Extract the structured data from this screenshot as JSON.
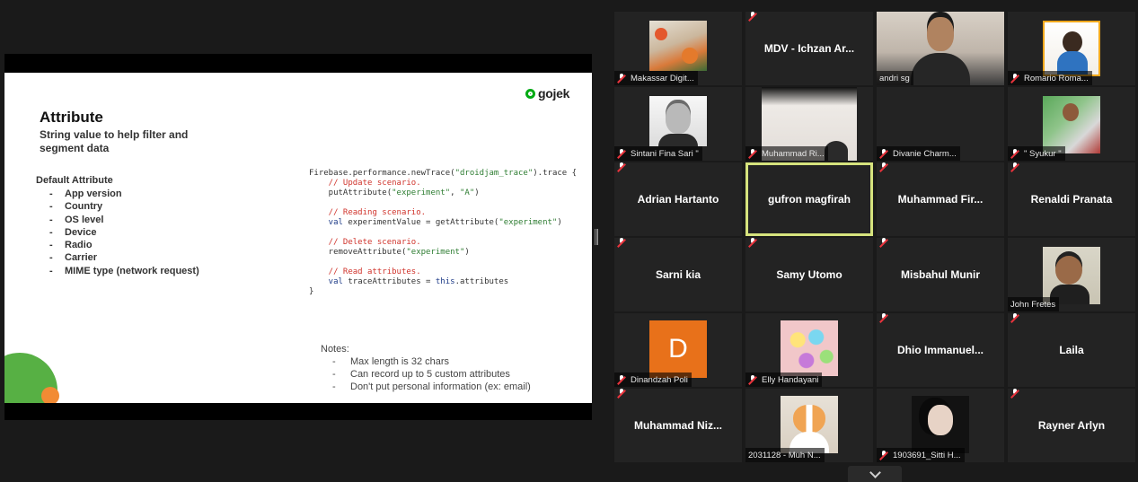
{
  "slide": {
    "logo": "gojek",
    "title": "Attribute",
    "subtitle": "String value to help filter and segment data",
    "default_heading": "Default Attribute",
    "default_items": [
      "App version",
      "Country",
      "OS level",
      "Device",
      "Radio",
      "Carrier",
      "MIME type (network request)"
    ],
    "bullet": "-",
    "code": {
      "l1_a": "Firebase.performance.newTrace(",
      "l1_str": "\"droidjam_trace\"",
      "l1_b": ").trace {",
      "l2": "    // Update scenario.",
      "l3_a": "    putAttribute(",
      "l3_s1": "\"experiment\"",
      "l3_sep": ", ",
      "l3_s2": "\"A\"",
      "l3_b": ")",
      "l5": "    // Reading scenario.",
      "l6_kw": "    val",
      "l6_a": " experimentValue = getAttribute(",
      "l6_str": "\"experiment\"",
      "l6_b": ")",
      "l8": "    // Delete scenario.",
      "l9_a": "    removeAttribute(",
      "l9_str": "\"experiment\"",
      "l9_b": ")",
      "l11": "    // Read attributes.",
      "l12_kw": "    val",
      "l12_a": " traceAttributes = ",
      "l12_kw2": "this",
      "l12_b": ".attributes",
      "l13": "}"
    },
    "notes_title": "Notes:",
    "notes": [
      "Max length is 32 chars",
      "Can record up to 5 custom attributes",
      "Don't put personal information (ex: email)"
    ]
  },
  "participants": [
    {
      "label": "Makassar Digit..."
    },
    {
      "center": "MDV - Ichzan Ar..."
    },
    {
      "label": "andri sg"
    },
    {
      "label": "Romario Roma..."
    },
    {
      "label": "Sintani Fina Sari \""
    },
    {
      "label": "Muhammad Ri..."
    },
    {
      "label": "Divanie Charm..."
    },
    {
      "label": "\" Syukur \""
    },
    {
      "center": "Adrian Hartanto"
    },
    {
      "center": "gufron magfirah"
    },
    {
      "center": "Muhammad  Fir..."
    },
    {
      "center": "Renaldi Pranata"
    },
    {
      "center": "Sarni kia"
    },
    {
      "center": "Samy Utomo"
    },
    {
      "center": "Misbahul Munir"
    },
    {
      "label": "John Fretes"
    },
    {
      "label": "Dinandzah Poli",
      "initial": "D"
    },
    {
      "label": "Elly Handayani"
    },
    {
      "center": "Dhio  Immanuel..."
    },
    {
      "center": "Laila"
    },
    {
      "center": "Muhammad  Niz..."
    },
    {
      "label": "2031128 - Muh N..."
    },
    {
      "label": "1903691_Sitti H..."
    },
    {
      "center": "Rayner Arlyn"
    }
  ],
  "colors": {
    "brand_green": "#00aa13",
    "active_speaker": "#d6e37d",
    "muted_mic": "#e8333c",
    "dinandzah_avatar": "#e8711a"
  },
  "icons": {
    "mic": "microphone-muted-icon",
    "scroll": "chevron-down-icon"
  }
}
